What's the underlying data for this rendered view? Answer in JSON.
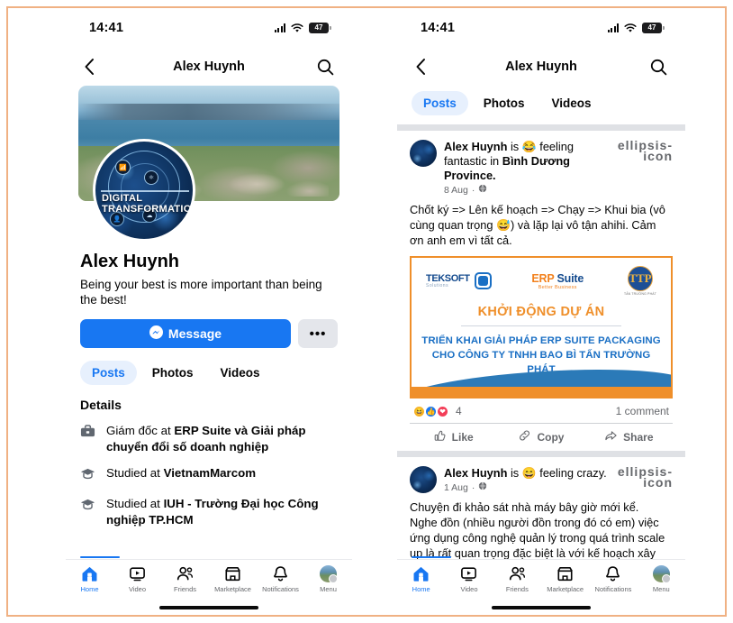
{
  "status": {
    "time": "14:41",
    "battery_level": "47",
    "signal_icon": "cellular-signal-icon",
    "wifi_icon": "wifi-icon",
    "battery_icon": "battery-icon"
  },
  "nav": {
    "back_icon": "chevron-left-icon",
    "title": "Alex Huynh",
    "search_icon": "search-icon"
  },
  "profile": {
    "name": "Alex Huynh",
    "bio": "Being your best is more important than being the best!",
    "message_button": "Message",
    "more_button": "•••",
    "avatar_text_line1": "DIGITAL",
    "avatar_text_line2": "TRANSFORMATIO"
  },
  "tabs": [
    {
      "label": "Posts",
      "active": true
    },
    {
      "label": "Photos",
      "active": false
    },
    {
      "label": "Videos",
      "active": false
    }
  ],
  "details": {
    "title": "Details",
    "items": [
      {
        "icon": "briefcase-icon",
        "prefix": "Giám đốc at ",
        "bold": "ERP Suite và Giải pháp chuyển đổi số doanh nghiệp",
        "suffix": ""
      },
      {
        "icon": "graduation-cap-icon",
        "prefix": "Studied at ",
        "bold": "VietnamMarcom",
        "suffix": ""
      },
      {
        "icon": "graduation-cap-icon",
        "prefix": "Studied at ",
        "bold": "IUH - Trường Đại học Công nghiệp TP.HCM",
        "suffix": ""
      }
    ]
  },
  "feed": {
    "posts": [
      {
        "author": "Alex Huynh",
        "action_prefix": " is ",
        "feeling_emoji": "😂",
        "feeling": " feeling fantastic in ",
        "location": "Bình Dương Province.",
        "date": "8 Aug",
        "privacy_icon": "globe-icon",
        "body": "Chốt ký => Lên kế hoạch => Chạy => Khui bia (vô cùng quan trọng 😅) và lặp lại vô tận ahihi. Cảm ơn anh em vì tất cả.",
        "menu_icon": "ellipsis-icon",
        "banner": {
          "logo_teksoft_name": "TEKSOFT",
          "logo_teksoft_sub": "Solutions",
          "logo_erp_orange": "ERP",
          "logo_erp_blue": " Suite",
          "logo_erp_sub": "Better Business",
          "logo_ttp_mark": "TTP",
          "logo_ttp_caption": "TẤN TRƯỜNG PHÁT",
          "heading": "KHỞI ĐỘNG DỰ ÁN",
          "subheading_line1": "TRIỂN KHAI GIẢI PHÁP ERP SUITE PACKAGING",
          "subheading_line2": "CHO CÔNG TY TNHH BAO BÌ TẤN TRƯỜNG PHÁT"
        },
        "reactions": {
          "icons": [
            "haha-reaction-icon",
            "like-reaction-icon",
            "love-reaction-icon"
          ],
          "count": "4",
          "comments": "1 comment"
        },
        "actions": [
          {
            "label": "Like",
            "icon": "thumbs-up-icon"
          },
          {
            "label": "Copy",
            "icon": "link-icon"
          },
          {
            "label": "Share",
            "icon": "share-icon"
          }
        ]
      },
      {
        "author": "Alex Huynh",
        "action_prefix": " is ",
        "feeling_emoji": "😄",
        "feeling": " feeling crazy.",
        "location": "",
        "date": "1 Aug",
        "privacy_icon": "globe-icon",
        "menu_icon": "ellipsis-icon",
        "body": "Chuyện đi khảo sát nhà máy bây giờ mới kể.\nNghe đồn (nhiều người đồn trong đó có em) việc ứng dụng công nghệ quản lý trong quá trình scale up là rất quan trọng đặc biệt là với kế hoạch xây thêm gì đó cạnh bên có quy mô không kém cái hiện tại. Quy trình thế nào, nguồn lực ra sao, chiến lược thế nào và"
      }
    ]
  },
  "tabbar": [
    {
      "label": "Home",
      "icon": "home-icon",
      "active": true
    },
    {
      "label": "Video",
      "icon": "video-icon",
      "active": false
    },
    {
      "label": "Friends",
      "icon": "friends-icon",
      "active": false
    },
    {
      "label": "Marketplace",
      "icon": "marketplace-icon",
      "active": false
    },
    {
      "label": "Notifications",
      "icon": "bell-icon",
      "active": false
    },
    {
      "label": "Menu",
      "icon": "profile-avatar-icon",
      "active": false
    }
  ],
  "colors": {
    "fb_blue": "#1877f2",
    "frame_border": "#f0b183",
    "banner_orange": "#ef8f2a",
    "banner_blue": "#1a6fc4",
    "text_primary": "#050505",
    "text_secondary": "#65676b"
  }
}
